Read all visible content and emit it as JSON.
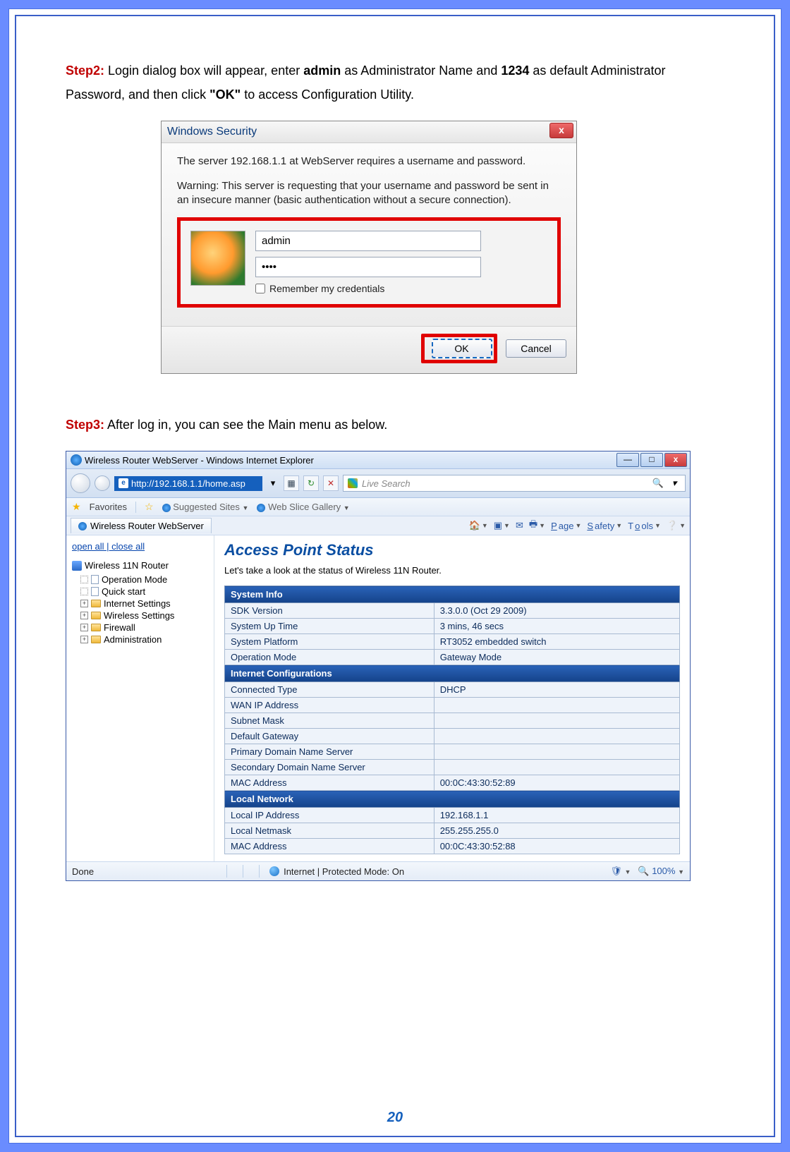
{
  "page_number": "20",
  "step2": {
    "label": "Step2:",
    "text_a": " Login dialog box will appear, enter ",
    "admin": "admin",
    "text_b": " as Administrator Name and ",
    "pwd": "1234",
    "text_c": " as default Administrator Password, and then click ",
    "ok": "\"OK\"",
    "text_d": " to access Configuration Utility."
  },
  "sec_dialog": {
    "title": "Windows Security",
    "close": "x",
    "msg1": "The server 192.168.1.1 at WebServer requires a username and password.",
    "msg2": "Warning: This server is requesting that your username and password be sent in an insecure manner (basic authentication without a secure connection).",
    "username": "admin",
    "password_mask": "••••",
    "remember": "Remember my credentials",
    "ok": "OK",
    "cancel": "Cancel"
  },
  "step3": {
    "label": "Step3:",
    "text": " After log in, you can see the Main menu as below."
  },
  "ie": {
    "title": "Wireless Router WebServer - Windows Internet Explorer",
    "url": "http://192.168.1.1/home.asp",
    "search_placeholder": "Live Search",
    "favorites": "Favorites",
    "suggested": "Suggested Sites",
    "webslice": "Web Slice Gallery",
    "tab": "Wireless Router WebServer",
    "tools": {
      "page": "Page",
      "safety": "Safety",
      "tools": "Tools"
    },
    "side": {
      "open_close": "open all | close all",
      "root": "Wireless 11N Router",
      "items": [
        {
          "box": "",
          "label": "Operation Mode"
        },
        {
          "box": "",
          "label": "Quick start"
        },
        {
          "box": "+",
          "label": "Internet Settings"
        },
        {
          "box": "+",
          "label": "Wireless Settings"
        },
        {
          "box": "+",
          "label": "Firewall"
        },
        {
          "box": "+",
          "label": "Administration"
        }
      ]
    },
    "main": {
      "title": "Access Point Status",
      "sub": "Let's take a look at the status of Wireless 11N Router.",
      "sections": [
        {
          "header": "System Info",
          "rows": [
            [
              "SDK Version",
              "3.3.0.0 (Oct 29 2009)"
            ],
            [
              "System Up Time",
              "3 mins, 46 secs"
            ],
            [
              "System Platform",
              "RT3052 embedded switch"
            ],
            [
              "Operation Mode",
              "Gateway Mode"
            ]
          ]
        },
        {
          "header": "Internet Configurations",
          "rows": [
            [
              "Connected Type",
              "DHCP"
            ],
            [
              "WAN IP Address",
              ""
            ],
            [
              "Subnet Mask",
              ""
            ],
            [
              "Default Gateway",
              ""
            ],
            [
              "Primary Domain Name Server",
              ""
            ],
            [
              "Secondary Domain Name Server",
              ""
            ],
            [
              "MAC Address",
              "00:0C:43:30:52:89"
            ]
          ]
        },
        {
          "header": "Local Network",
          "rows": [
            [
              "Local IP Address",
              "192.168.1.1"
            ],
            [
              "Local Netmask",
              "255.255.255.0"
            ],
            [
              "MAC Address",
              "00:0C:43:30:52:88"
            ]
          ]
        }
      ]
    },
    "status": {
      "done": "Done",
      "zone": "Internet | Protected Mode: On",
      "zoom": "100%"
    }
  }
}
